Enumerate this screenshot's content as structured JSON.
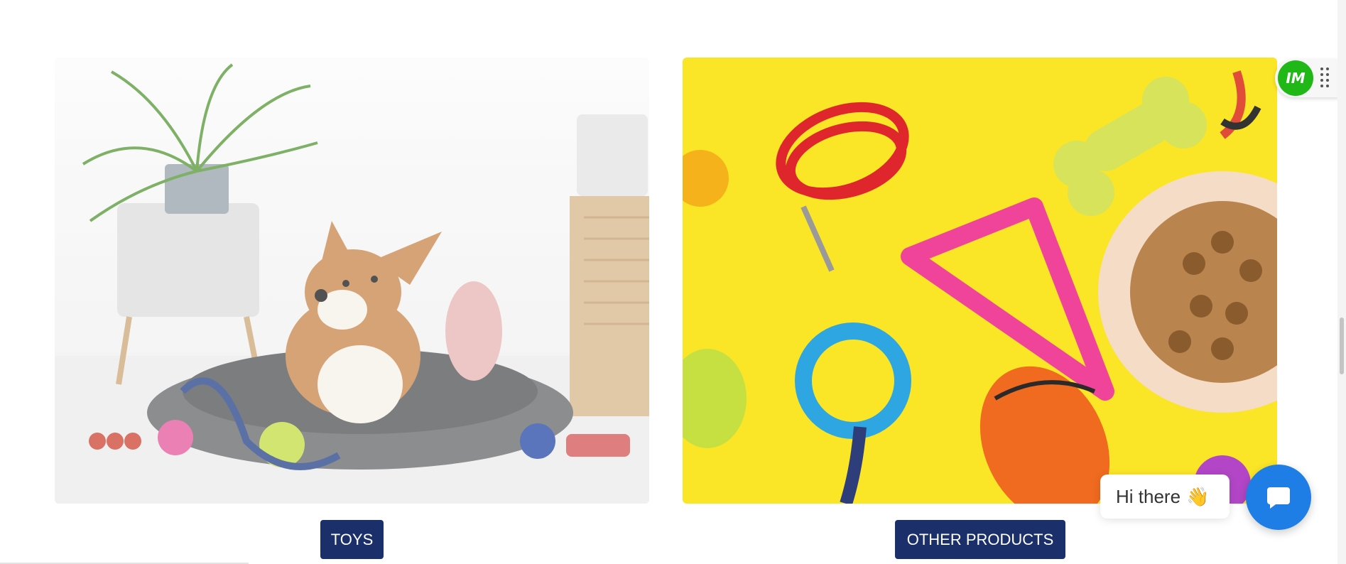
{
  "categories": [
    {
      "label": "TOYS",
      "image": "dog-with-toys-photo"
    },
    {
      "label": "OTHER PRODUCTS",
      "image": "pet-products-yellow-photo"
    }
  ],
  "widget": {
    "logo_text": "IM"
  },
  "chat": {
    "greeting": "Hi there",
    "greeting_emoji": "👋"
  },
  "colors": {
    "button_bg": "#1b2f6b",
    "chat_bg": "#1e7ee6",
    "widget_logo_bg": "#1fb817",
    "yellow_bg": "#fbe527"
  }
}
